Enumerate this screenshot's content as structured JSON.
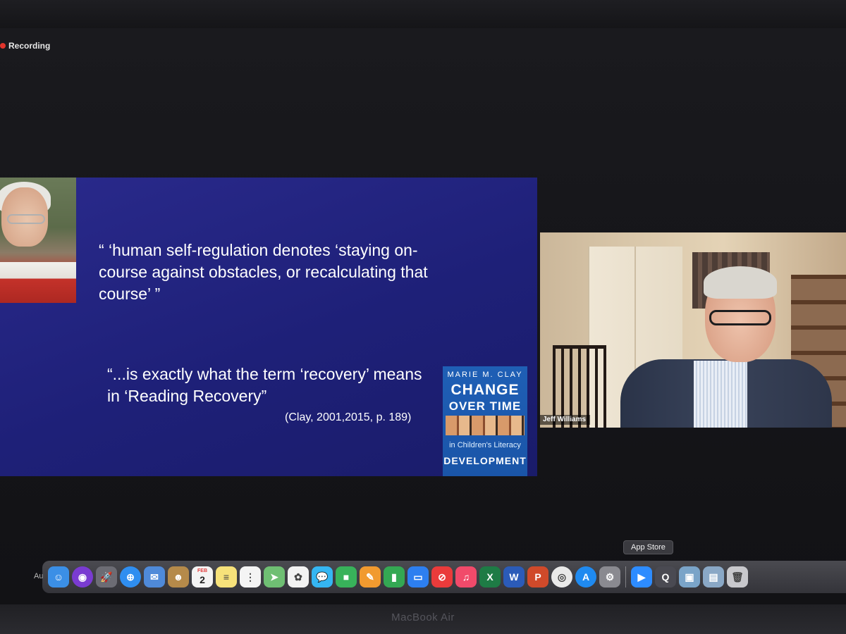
{
  "status": {
    "recording_label": "Recording"
  },
  "slide": {
    "quote_1": "“ ‘human self-regulation denotes ‘staying on-course against obstacles, or recalculating that course’ ”",
    "quote_2": "“...is exactly what the term ‘recovery’ means in ‘Reading Recovery”",
    "citation": "(Clay, 2001,2015, p. 189)",
    "book": {
      "author": "MARIE M. CLAY",
      "title_line_1": "CHANGE",
      "title_line_2": "OVER TIME",
      "subtitle": "in Children's Literacy",
      "title_line_3": "DEVELOPMENT"
    }
  },
  "video": {
    "participant_name": "Jeff Williams"
  },
  "dock": {
    "left_label": "Au",
    "tooltip": "App Store",
    "calendar_month": "FEB",
    "calendar_day": "2",
    "icons": [
      {
        "name": "finder-icon",
        "color": "#3b8fe6",
        "glyph": "☺"
      },
      {
        "name": "siri-icon",
        "color": "#7a3bd1",
        "glyph": "◉"
      },
      {
        "name": "launchpad-icon",
        "color": "#6c6c74",
        "glyph": "🚀"
      },
      {
        "name": "safari-icon",
        "color": "#2f8ef0",
        "glyph": "⊕"
      },
      {
        "name": "mail-icon",
        "color": "#4f8ad9",
        "glyph": "✉"
      },
      {
        "name": "contacts-icon",
        "color": "#b58a4a",
        "glyph": "☻"
      },
      {
        "name": "calendar-icon",
        "color": "#f4f4f4",
        "glyph": ""
      },
      {
        "name": "notes-icon",
        "color": "#f7e27a",
        "glyph": "≡"
      },
      {
        "name": "reminders-icon",
        "color": "#f4f4f4",
        "glyph": "⋮"
      },
      {
        "name": "maps-icon",
        "color": "#6fbf73",
        "glyph": "➤"
      },
      {
        "name": "photos-icon",
        "color": "#f2f2f2",
        "glyph": "✿"
      },
      {
        "name": "messages-icon",
        "color": "#35b6f2",
        "glyph": "💬"
      },
      {
        "name": "facetime-icon",
        "color": "#38b25a",
        "glyph": "■"
      },
      {
        "name": "pages-icon",
        "color": "#f19a2f",
        "glyph": "✎"
      },
      {
        "name": "numbers-icon",
        "color": "#34a853",
        "glyph": "▮"
      },
      {
        "name": "keynote-icon",
        "color": "#2d7ff0",
        "glyph": "▭"
      },
      {
        "name": "news-icon",
        "color": "#ea3b3b",
        "glyph": "⊘"
      },
      {
        "name": "music-icon",
        "color": "#f14a6a",
        "glyph": "♫"
      },
      {
        "name": "excel-icon",
        "color": "#1e7b45",
        "glyph": "X"
      },
      {
        "name": "word-icon",
        "color": "#2b5bb8",
        "glyph": "W"
      },
      {
        "name": "powerpoint-icon",
        "color": "#d04a2a",
        "glyph": "P"
      },
      {
        "name": "chrome-icon",
        "color": "#e9e9e9",
        "glyph": "◎"
      },
      {
        "name": "app-store-icon",
        "color": "#1f8af0",
        "glyph": "A"
      },
      {
        "name": "system-preferences-icon",
        "color": "#8a8a90",
        "glyph": "⚙"
      }
    ],
    "icons_right": [
      {
        "name": "zoom-icon",
        "color": "#2d8cff",
        "glyph": "▶"
      },
      {
        "name": "quicktime-icon",
        "color": "#4a4a52",
        "glyph": "Q"
      },
      {
        "name": "preview-icon",
        "color": "#7aa4c8",
        "glyph": "▣"
      },
      {
        "name": "downloads-folder-icon",
        "color": "#8aa8c6",
        "glyph": "▤"
      },
      {
        "name": "trash-icon",
        "color": "#c8c8cc",
        "glyph": "🗑"
      }
    ]
  },
  "device": {
    "label": "MacBook Air"
  }
}
